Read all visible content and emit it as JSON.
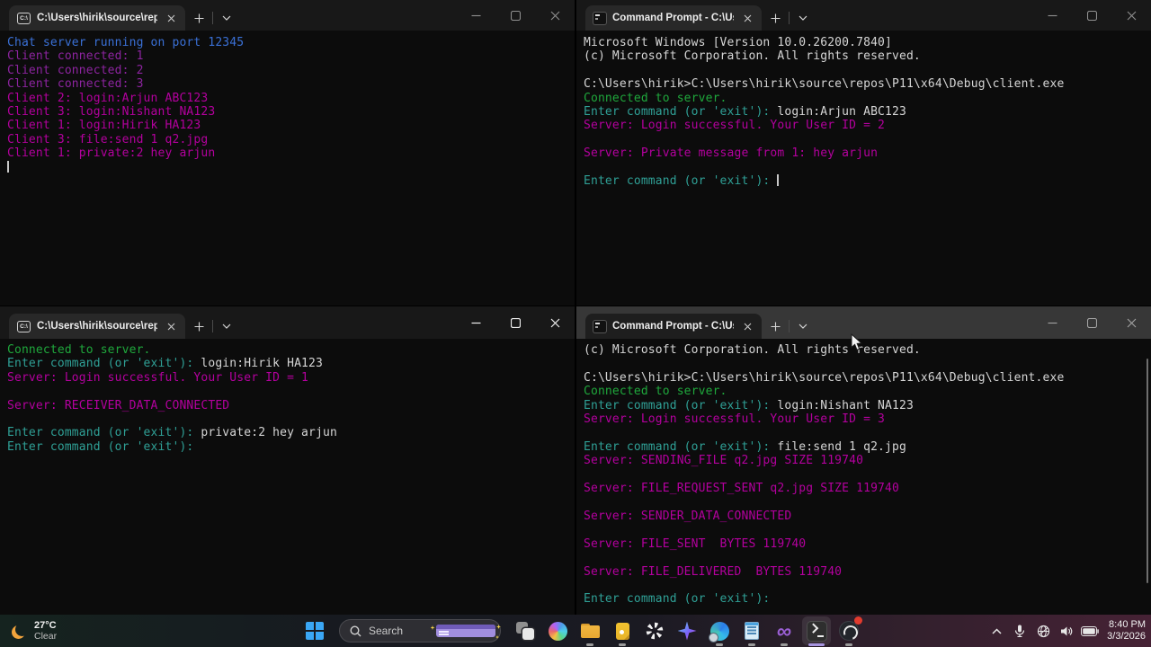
{
  "colors": {
    "fg": "#d6d6d6",
    "blue": "#3a70d6",
    "purple": "#8d24a0",
    "magenta": "#b4009e",
    "green": "#1fa83c",
    "prompt": "#2fa096"
  },
  "chrome": {
    "cmd_icon_label": "C:\\"
  },
  "windows": {
    "server": {
      "tab_title": "C:\\Users\\hirik\\source\\repos\\P",
      "lines": [
        [
          {
            "t": "Chat server running on port 12345",
            "c": "blue"
          }
        ],
        [
          {
            "t": "Client connected: 1",
            "c": "purple"
          }
        ],
        [
          {
            "t": "Client connected: 2",
            "c": "purple"
          }
        ],
        [
          {
            "t": "Client connected: 3",
            "c": "purple"
          }
        ],
        [
          {
            "t": "Client 2: login:Arjun ABC123",
            "c": "magenta"
          }
        ],
        [
          {
            "t": "Client 3: login:Nishant NA123",
            "c": "magenta"
          }
        ],
        [
          {
            "t": "Client 1: login:Hirik HA123",
            "c": "magenta"
          }
        ],
        [
          {
            "t": "Client 3: file:send 1 q2.jpg",
            "c": "magenta"
          }
        ],
        [
          {
            "t": "Client 1: private:2 hey arjun",
            "c": "magenta"
          }
        ],
        [
          {
            "cursor": true
          }
        ]
      ]
    },
    "arjun": {
      "tab_title": "Command Prompt - C:\\Users\\",
      "lines": [
        [
          {
            "t": "Microsoft Windows [Version 10.0.26200.7840]",
            "c": "fg"
          }
        ],
        [
          {
            "t": "(c) Microsoft Corporation. All rights reserved.",
            "c": "fg"
          }
        ],
        [],
        [
          {
            "t": "C:\\Users\\hirik>C:\\Users\\hirik\\source\\repos\\P11\\x64\\Debug\\client.exe",
            "c": "fg"
          }
        ],
        [
          {
            "t": "Connected to server.",
            "c": "green"
          }
        ],
        [
          {
            "t": "Enter command (or 'exit'): ",
            "c": "prompt"
          },
          {
            "t": "login:Arjun ABC123",
            "c": "fg"
          }
        ],
        [
          {
            "t": "Server: Login successful. Your User ID = 2",
            "c": "magenta"
          }
        ],
        [],
        [
          {
            "t": "Server: Private message from 1: hey arjun",
            "c": "magenta"
          }
        ],
        [],
        [
          {
            "t": "Enter command (or 'exit'): ",
            "c": "prompt"
          },
          {
            "cursor": true
          }
        ]
      ]
    },
    "hirik": {
      "tab_title": "C:\\Users\\hirik\\source\\repos\\P",
      "lines": [
        [
          {
            "t": "Connected to server.",
            "c": "green"
          }
        ],
        [
          {
            "t": "Enter command (or 'exit'): ",
            "c": "prompt"
          },
          {
            "t": "login:Hirik HA123",
            "c": "fg"
          }
        ],
        [
          {
            "t": "Server: Login successful. Your User ID = 1",
            "c": "magenta"
          }
        ],
        [],
        [
          {
            "t": "Server: RECEIVER_DATA_CONNECTED",
            "c": "magenta"
          }
        ],
        [],
        [
          {
            "t": "Enter command (or 'exit'): ",
            "c": "prompt"
          },
          {
            "t": "private:2 hey arjun",
            "c": "fg"
          }
        ],
        [
          {
            "t": "Enter command (or 'exit'):",
            "c": "prompt"
          }
        ]
      ]
    },
    "nishant": {
      "tab_title": "Command Prompt - C:\\Users\\",
      "lines": [
        [
          {
            "t": "(c) Microsoft Corporation. All rights reserved.",
            "c": "fg"
          }
        ],
        [],
        [
          {
            "t": "C:\\Users\\hirik>C:\\Users\\hirik\\source\\repos\\P11\\x64\\Debug\\client.exe",
            "c": "fg"
          }
        ],
        [
          {
            "t": "Connected to server.",
            "c": "green"
          }
        ],
        [
          {
            "t": "Enter command (or 'exit'): ",
            "c": "prompt"
          },
          {
            "t": "login:Nishant NA123",
            "c": "fg"
          }
        ],
        [
          {
            "t": "Server: Login successful. Your User ID = 3",
            "c": "magenta"
          }
        ],
        [],
        [
          {
            "t": "Enter command (or 'exit'): ",
            "c": "prompt"
          },
          {
            "t": "file:send 1 q2.jpg",
            "c": "fg"
          }
        ],
        [
          {
            "t": "Server: SENDING_FILE q2.jpg SIZE 119740",
            "c": "magenta"
          }
        ],
        [],
        [
          {
            "t": "Server: FILE_REQUEST_SENT q2.jpg SIZE 119740",
            "c": "magenta"
          }
        ],
        [],
        [
          {
            "t": "Server: SENDER_DATA_CONNECTED",
            "c": "magenta"
          }
        ],
        [],
        [
          {
            "t": "Server: FILE_SENT  BYTES 119740",
            "c": "magenta"
          }
        ],
        [],
        [
          {
            "t": "Server: FILE_DELIVERED  BYTES 119740",
            "c": "magenta"
          }
        ],
        [],
        [
          {
            "t": "Enter command (or 'exit'):",
            "c": "prompt"
          }
        ]
      ]
    }
  },
  "taskbar": {
    "weather": {
      "temp": "27°C",
      "condition": "Clear"
    },
    "search_placeholder": "Search",
    "icons": [
      "start",
      "search",
      "task-view",
      "copilot",
      "file-explorer",
      "sticky-notes",
      "chatgpt",
      "gemini-star",
      "edge",
      "notepad",
      "visual-studio",
      "terminal",
      "obs-studio"
    ],
    "tray": {
      "time": "8:40 PM",
      "date": "3/3/2026"
    }
  }
}
